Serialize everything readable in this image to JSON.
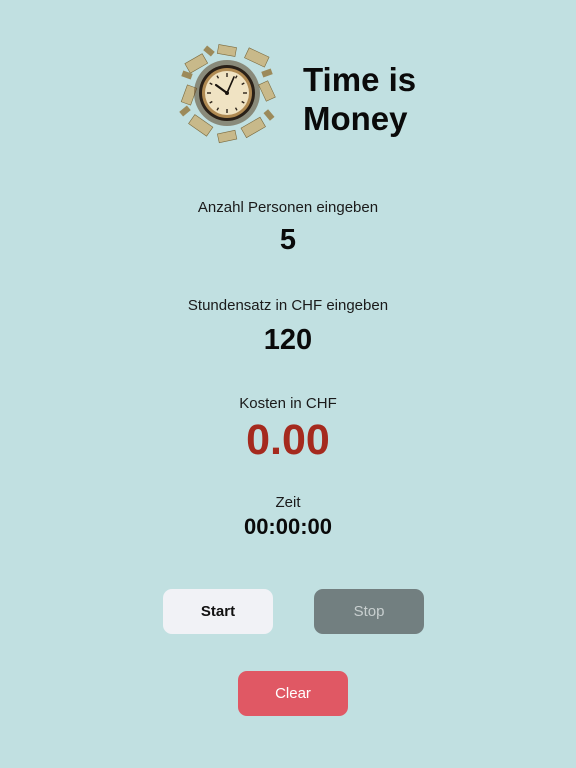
{
  "app": {
    "title": "Time is Money"
  },
  "logo": {
    "icon": "clock-with-money-icon"
  },
  "persons": {
    "label": "Anzahl Personen eingeben",
    "value": "5"
  },
  "rate": {
    "label": "Stundensatz in CHF eingeben",
    "value": "120"
  },
  "cost": {
    "label": "Kosten in CHF",
    "value": "0.00",
    "color": "#a52a1e"
  },
  "time": {
    "label": "Zeit",
    "value": "00:00:00"
  },
  "buttons": {
    "start_label": "Start",
    "stop_label": "Stop",
    "clear_label": "Clear"
  },
  "colors": {
    "background": "#c1e0e1",
    "start_button": "#f1f2f6",
    "stop_button": "#727f80",
    "clear_button": "#e05864"
  }
}
